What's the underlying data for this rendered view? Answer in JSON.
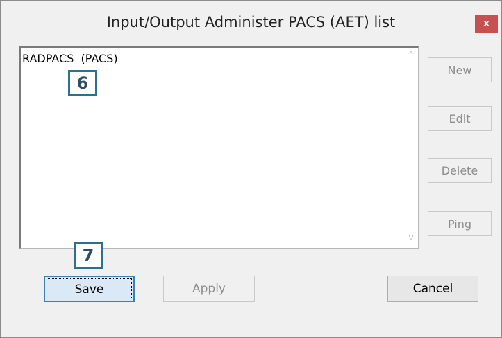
{
  "window": {
    "title": "Input/Output Administer PACS (AET) list",
    "close_glyph": "x"
  },
  "list": {
    "items": [
      {
        "label": "RADPACS  (PACS)"
      }
    ],
    "scroll_up_glyph": "^",
    "scroll_down_glyph": "v"
  },
  "side_buttons": {
    "new_label": "New",
    "edit_label": "Edit",
    "delete_label": "Delete",
    "ping_label": "Ping"
  },
  "bottom_buttons": {
    "save_label": "Save",
    "apply_label": "Apply",
    "cancel_label": "Cancel"
  },
  "callouts": {
    "list_marker": "6",
    "save_marker": "7"
  },
  "colors": {
    "close_button": "#c75050",
    "callout_border": "#2e6e8e",
    "save_focus_border": "#3c7fb1"
  }
}
